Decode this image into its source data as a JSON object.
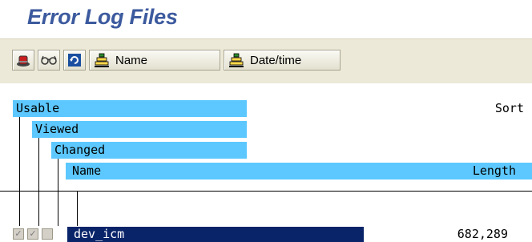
{
  "page": {
    "title": "Error Log Files"
  },
  "toolbar": {
    "name_label": "Name",
    "datetime_label": "Date/time"
  },
  "header": {
    "usable": "Usable",
    "viewed": "Viewed",
    "changed": "Changed",
    "name": "Name",
    "sort": "Sort",
    "length": "Length"
  },
  "rows": [
    {
      "usable": true,
      "viewed": true,
      "changed": false,
      "name": "dev_icm",
      "length": "682,289"
    }
  ],
  "colors": {
    "header_band": "#5cc8ff",
    "selection": "#0a246a",
    "title": "#3c5a9e"
  }
}
